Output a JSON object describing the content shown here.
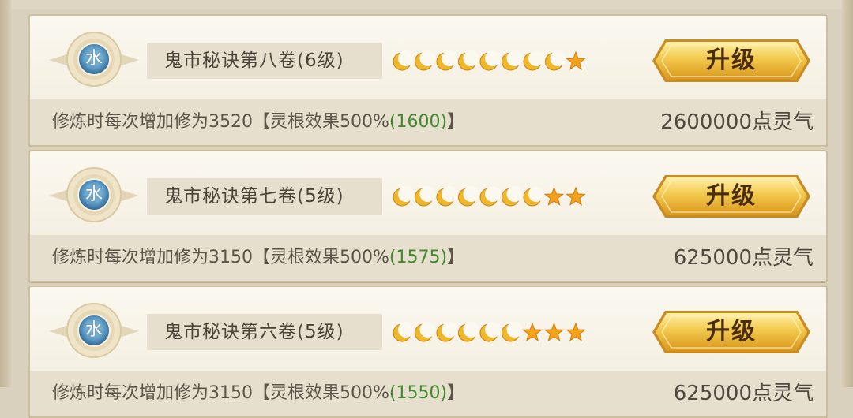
{
  "scrolls": [
    {
      "element": "水",
      "name": "鬼市秘诀第八卷(6级)",
      "moons": 8,
      "stars": 1,
      "button_label": "升级",
      "desc_prefix": "修炼时每次增加修为3520【灵根效果500%",
      "desc_value": "(1600)",
      "desc_suffix": "】",
      "cost": "2600000点灵气"
    },
    {
      "element": "水",
      "name": "鬼市秘诀第七卷(5级)",
      "moons": 7,
      "stars": 2,
      "button_label": "升级",
      "desc_prefix": "修炼时每次增加修为3150【灵根效果500%",
      "desc_value": "(1575)",
      "desc_suffix": "】",
      "cost": "625000点灵气"
    },
    {
      "element": "水",
      "name": "鬼市秘诀第六卷(5级)",
      "moons": 6,
      "stars": 3,
      "button_label": "升级",
      "desc_prefix": "修炼时每次增加修为3150【灵根效果500%",
      "desc_value": "(1550)",
      "desc_suffix": "】",
      "cost": "625000点灵气"
    }
  ],
  "colors": {
    "button_gold": "#f2c84b",
    "moon": "#f0b72a",
    "star": "#f4a21c",
    "green_value": "#3f8a2a"
  }
}
